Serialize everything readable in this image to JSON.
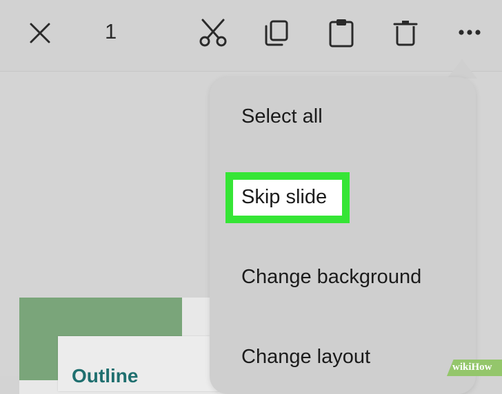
{
  "toolbar": {
    "selection_count": "1",
    "icons": {
      "close": "close-icon",
      "cut": "scissors-icon",
      "copy": "copy-icon",
      "paste": "clipboard-icon",
      "delete": "trash-icon",
      "more": "more-horizontal-icon"
    }
  },
  "menu": {
    "items": [
      {
        "label": "Select all"
      },
      {
        "label": "Skip slide",
        "highlighted": true
      },
      {
        "label": "Change background"
      },
      {
        "label": "Change layout"
      }
    ]
  },
  "slide": {
    "title": "Outline"
  },
  "watermark": {
    "text": "wikiHow"
  },
  "colors": {
    "highlight": "#35e535",
    "slide_accent": "#7aa57a",
    "slide_title": "#1f6f6f",
    "watermark_bg": "#94c66b"
  }
}
